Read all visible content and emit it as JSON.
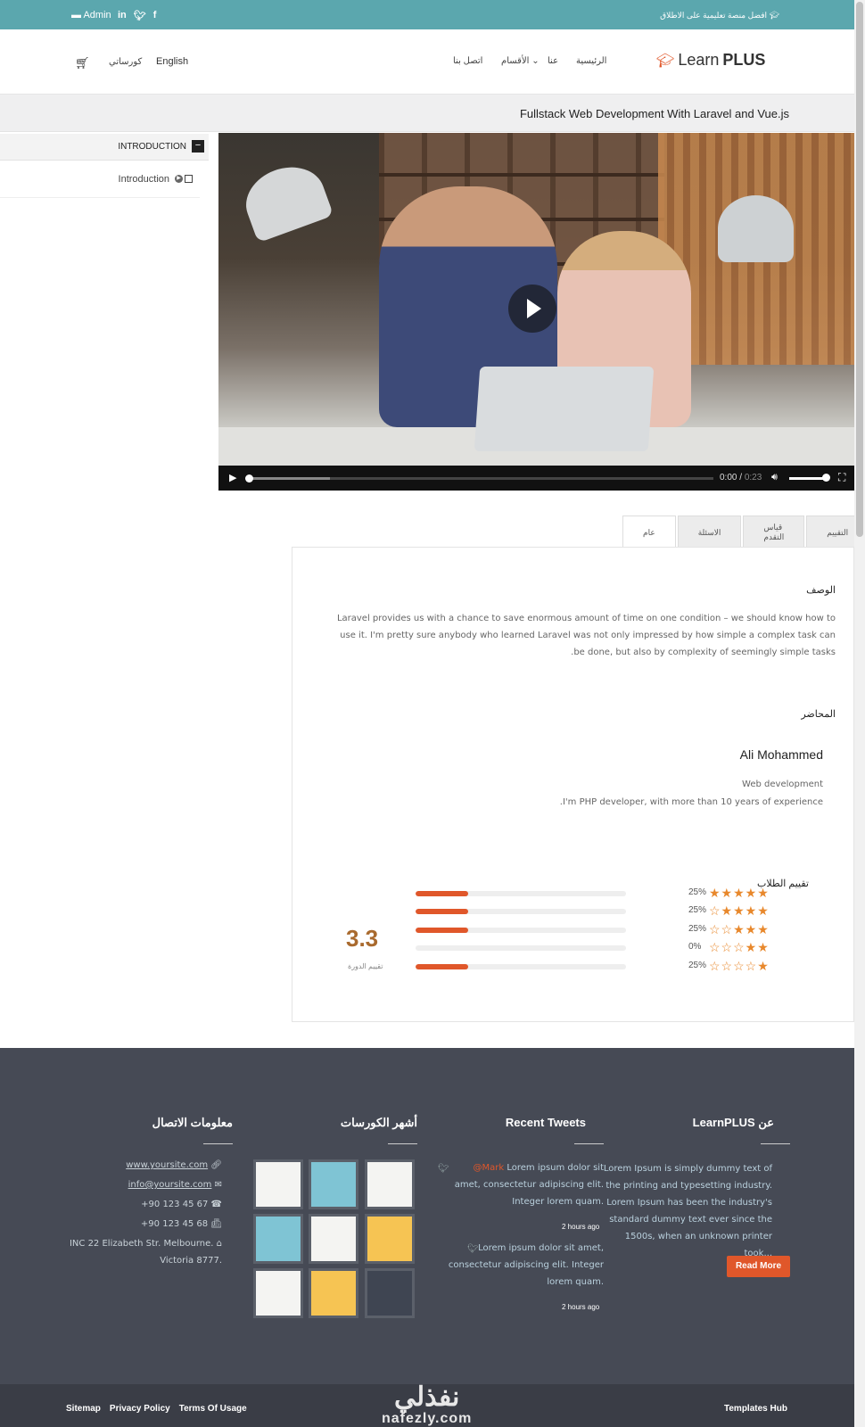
{
  "topbar": {
    "admin_label": "Admin",
    "tagline": "افضل منصة تعليمية على الاطلاق"
  },
  "header": {
    "logo_light": "Learn",
    "logo_bold": "PLUS",
    "nav": [
      "الرئيسية",
      "عنا",
      "الأقسام",
      "اتصل بنا"
    ],
    "language": "English",
    "my_courses": "كورساتي"
  },
  "course": {
    "title": "Fullstack Web Development With Laravel and Vue.js"
  },
  "sidebar": {
    "section": "INTRODUCTION",
    "lesson": "Introduction"
  },
  "video": {
    "time": "0:00",
    "duration": "0:23",
    "progress": 0
  },
  "tabs": [
    "التقييم",
    "قياس التقدم",
    "الاسئلة",
    "عام"
  ],
  "active_tab": "عام",
  "panel": {
    "description_title": "الوصف",
    "description": "Laravel provides us with a chance to save enormous amount of time on one condition – we should know how to use it. I'm pretty sure anybody who learned Laravel was not only impressed by how simple a complex task can be done, but also by complexity of seemingly simple tasks.",
    "instructor_title": "المحاضر",
    "instructor_name": "Ali Mohammed",
    "instructor_role": "Web development",
    "instructor_bio": "I'm PHP developer, with more than 10 years of experience.",
    "ratings_title": "تقييم الطلاب",
    "ratings": [
      {
        "stars": 5,
        "percent": "25%",
        "fill": 0.25
      },
      {
        "stars": 4,
        "percent": "25%",
        "fill": 0.25
      },
      {
        "stars": 3,
        "percent": "25%",
        "fill": 0.25
      },
      {
        "stars": 2,
        "percent": "0%",
        "fill": 0
      },
      {
        "stars": 1,
        "percent": "25%",
        "fill": 0.25
      }
    ],
    "score": "3.3",
    "score_label": "تقييم الدورة"
  },
  "footer": {
    "about_title": "عن LearnPLUS",
    "about_text": "Lorem Ipsum is simply dummy text of the printing and typesetting industry. Lorem Ipsum has been the industry's standard dummy text ever since the 1500s, when an unknown printer took...",
    "read_more": "Read More",
    "tweets_title": "Recent Tweets",
    "tweets": [
      {
        "handle": "@Mark",
        "text": "Lorem ipsum dolor sit amet, consectetur adipiscing elit. Integer lorem quam.",
        "time": "2 hours ago"
      },
      {
        "handle": "",
        "text": "Lorem ipsum dolor sit amet, consectetur adipiscing elit. Integer lorem quam.",
        "time": "2 hours ago"
      }
    ],
    "courses_title": "أشهر الكورسات",
    "contact_title": "معلومات الاتصال",
    "contact": {
      "website": "www.yoursite.com",
      "email": "info@yoursite.com",
      "phone": "+90 123 45 67",
      "fax": "+90 123 45 68",
      "address1": "22 Elizabeth Str. Melbourne.",
      "address1b": "INC",
      "address2": "Victoria 8777."
    }
  },
  "bottom": {
    "links": [
      "Sitemap",
      "Privacy Policy",
      "Terms Of Usage"
    ],
    "right": "Templates Hub",
    "watermark_ar": "نفذلي",
    "watermark_en": "nafezly.com"
  },
  "colors": {
    "topbar": "#5ba7ae",
    "accent": "#e0572a",
    "footer": "#464a55",
    "star": "#e8882c"
  }
}
